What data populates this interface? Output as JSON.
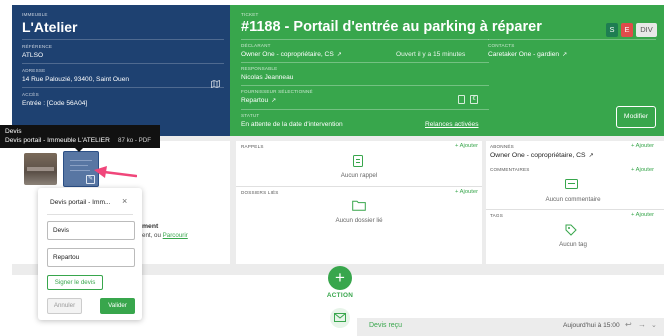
{
  "immeuble": {
    "kicker": "IMMEUBLE",
    "name": "L'Atelier",
    "ref_label": "RÉFÉRENCE",
    "ref_value": "ATLSO",
    "address_label": "ADRESSE",
    "address_value": "14 Rue Palouzié, 93400, Saint Ouen",
    "access_label": "ACCÈS",
    "access_value": "Entrée : [Code 56A04]"
  },
  "ticket": {
    "kicker": "TICKET",
    "title": "#1188 - Portail d'entrée au parking à réparer",
    "badges": [
      {
        "label": "S",
        "color": "#1e7d52"
      },
      {
        "label": "E",
        "color": "#e04b4b"
      },
      {
        "label": "DIV",
        "color": "#e8e8e8"
      }
    ],
    "declarant_label": "DÉCLARANT",
    "declarant_value": "Owner One - copropriétaire, CS",
    "opened": "Ouvert il y a 15 minutes",
    "contacts_label": "CONTACTS",
    "contacts_value": "Caretaker One - gardien",
    "responsable_label": "RESPONSABLE",
    "responsable_value": "Nicolas Jeanneau",
    "fournisseur_label": "FOURNISSEUR SÉLECTIONNÉ",
    "fournisseur_value": "Repartou",
    "statut_label": "STATUT",
    "statut_value": "En attente de la date d'intervention",
    "relances": "Relances activées",
    "modifier": "Modifier"
  },
  "tooltip": {
    "title": "Devis",
    "name": "Devis portail - Immeuble L'ATELIER",
    "meta": "87 ko - PDF"
  },
  "rappels": {
    "title": "RAPPELS",
    "add": "+ Ajouter",
    "empty": "Aucun rappel"
  },
  "dossiers": {
    "title": "DOSSIERS LIÉS",
    "add": "+ Ajouter",
    "empty": "Aucun dossier lié"
  },
  "abonnes": {
    "title": "ABONNÉS",
    "add": "+ Ajouter",
    "value": "Owner One - copropriétaire, CS"
  },
  "commentaires": {
    "title": "COMMENTAIRES",
    "add": "+ Ajouter",
    "empty": "Aucun commentaire"
  },
  "tags": {
    "title": "TAGS",
    "add": "+ Ajouter",
    "empty": "Aucun tag"
  },
  "upload": {
    "line1": "ment",
    "line2": "ent, ou",
    "link": "Parcourir"
  },
  "popup": {
    "doc_name": "Devis portail - Imm...",
    "type_value": "Devis",
    "fournisseur_value": "Repartou",
    "sign_button": "Signer le devis",
    "cancel_button": "Annuler",
    "validate_button": "Valider"
  },
  "action": {
    "label": "ACTION"
  },
  "timeline": {
    "title": "Devis reçu",
    "time": "Aujourd'hui à 15:00"
  },
  "colors": {
    "navy": "#1e4171",
    "green": "#38a64c",
    "accent_arrow": "#f0467a"
  }
}
